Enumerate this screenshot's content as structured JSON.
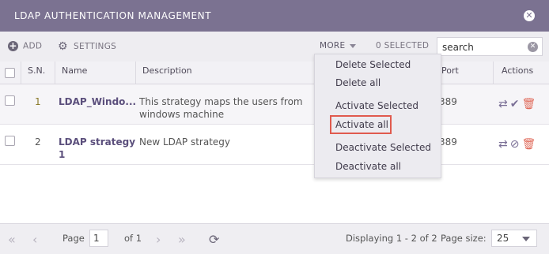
{
  "window": {
    "title": "LDAP AUTHENTICATION MANAGEMENT",
    "close_icon": "close-icon"
  },
  "toolbar": {
    "add_label": "ADD",
    "settings_label": "SETTINGS",
    "more_label": "MORE",
    "selected_label": "0 SELECTED",
    "search_value": "search"
  },
  "table": {
    "headers": [
      "S.N.",
      "Name",
      "Description",
      "Port",
      "Actions"
    ],
    "rows": [
      {
        "sn": "1",
        "name": "LDAP_Windo...",
        "description_line1": "This strategy maps the users from 10.45",
        "description_line2": "windows machine",
        "port": "389"
      },
      {
        "sn": "2",
        "name_line1": "LDAP strategy",
        "name_line2": "1",
        "description_line1": "New LDAP strategy",
        "port": "389"
      }
    ]
  },
  "more_menu": {
    "items": [
      "Delete Selected",
      "Delete all",
      "Activate Selected",
      "Activate all",
      "Deactivate Selected",
      "Deactivate all"
    ],
    "highlighted": "Activate all",
    "highlight_color": "#e05a4e"
  },
  "footer": {
    "page_label": "Page",
    "page_value": "1",
    "of_label": "of 1",
    "displaying": "Displaying 1 - 2 of 2",
    "page_size_label": "Page size:",
    "page_size_value": "25"
  },
  "colors": {
    "titlebar": "#7b7291",
    "accent": "#5b4f7c",
    "trash": "#e06a5a"
  }
}
